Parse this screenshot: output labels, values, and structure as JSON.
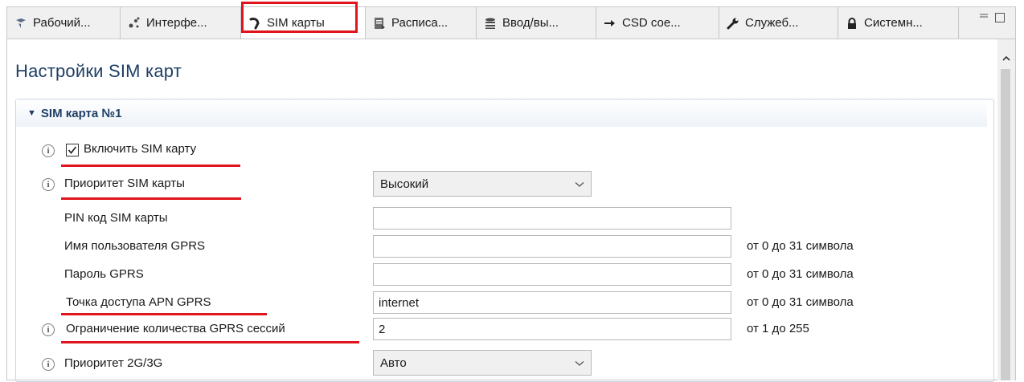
{
  "tabs": [
    {
      "label": "Рабочий...",
      "icon": "desktop-icon"
    },
    {
      "label": "Интерфе...",
      "icon": "interfaces-icon"
    },
    {
      "label": "SIM карты",
      "icon": "sim-icon"
    },
    {
      "label": "Расписа...",
      "icon": "schedule-icon"
    },
    {
      "label": "Ввод/вы...",
      "icon": "database-icon"
    },
    {
      "label": "CSD сое...",
      "icon": "arrow-right-icon"
    },
    {
      "label": "Служеб...",
      "icon": "wrench-icon"
    },
    {
      "label": "Системн...",
      "icon": "lock-icon"
    }
  ],
  "active_tab": "SIM карты",
  "page_title": "Настройки SIM карт",
  "section": {
    "title": "SIM карта №1",
    "enable_sim": {
      "label": "Включить SIM карту",
      "checked": true
    },
    "sim_priority": {
      "label": "Приоритет SIM карты",
      "value": "Высокий"
    },
    "pin_code": {
      "label": "PIN код SIM карты",
      "value": ""
    },
    "gprs_user": {
      "label": "Имя пользователя GPRS",
      "value": "",
      "hint": "от 0 до 31 символа"
    },
    "gprs_password": {
      "label": "Пароль GPRS",
      "value": "",
      "hint": "от 0 до 31 символа"
    },
    "apn": {
      "label": "Точка доступа APN GPRS",
      "value": "internet",
      "hint": "от 0 до 31 символа"
    },
    "gprs_sessions": {
      "label": "Ограничение количества GPRS сессий",
      "value": "2",
      "hint": "от 1 до 255"
    },
    "net_priority": {
      "label": "Приоритет 2G/3G",
      "value": "Авто"
    }
  },
  "colors": {
    "accent_title": "#1f3f66",
    "highlight": "#e0141c"
  }
}
